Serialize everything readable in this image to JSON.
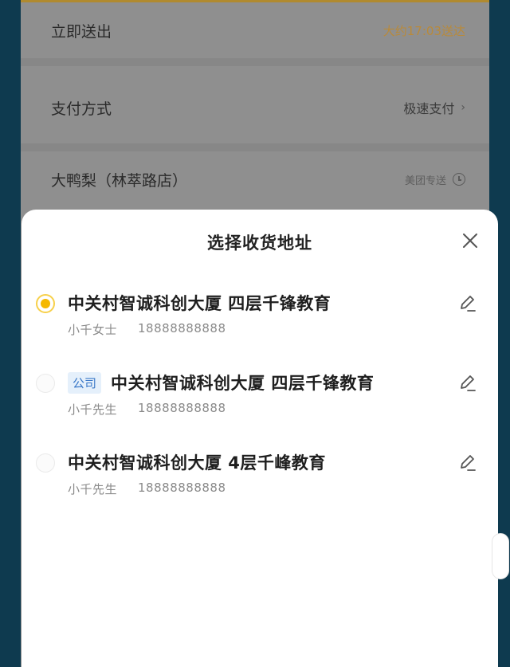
{
  "background": {
    "rows": [
      {
        "label": "立即送出",
        "value": "大约17:03送达"
      },
      {
        "label": "支付方式",
        "value": "极速支付",
        "chevron": "›"
      },
      {
        "label": "大鸭梨（林萃路店）",
        "value": "美团专送"
      }
    ]
  },
  "sheet": {
    "title": "选择收货地址",
    "addresses": [
      {
        "tag": "",
        "address": "中关村智诚科创大厦 四层千锋教育",
        "name": "小千女士",
        "phone": "18888888888",
        "selected": true
      },
      {
        "tag": "公司",
        "address": "中关村智诚科创大厦 四层千锋教育",
        "name": "小千先生",
        "phone": "18888888888",
        "selected": false
      },
      {
        "tag": "",
        "address": "中关村智诚科创大厦 4层千峰教育",
        "name": "小千先生",
        "phone": "18888888888",
        "selected": false
      }
    ]
  },
  "colors": {
    "accent": "#f5b800",
    "tag_bg": "#e5f0fb",
    "tag_text": "#3a78c8"
  }
}
